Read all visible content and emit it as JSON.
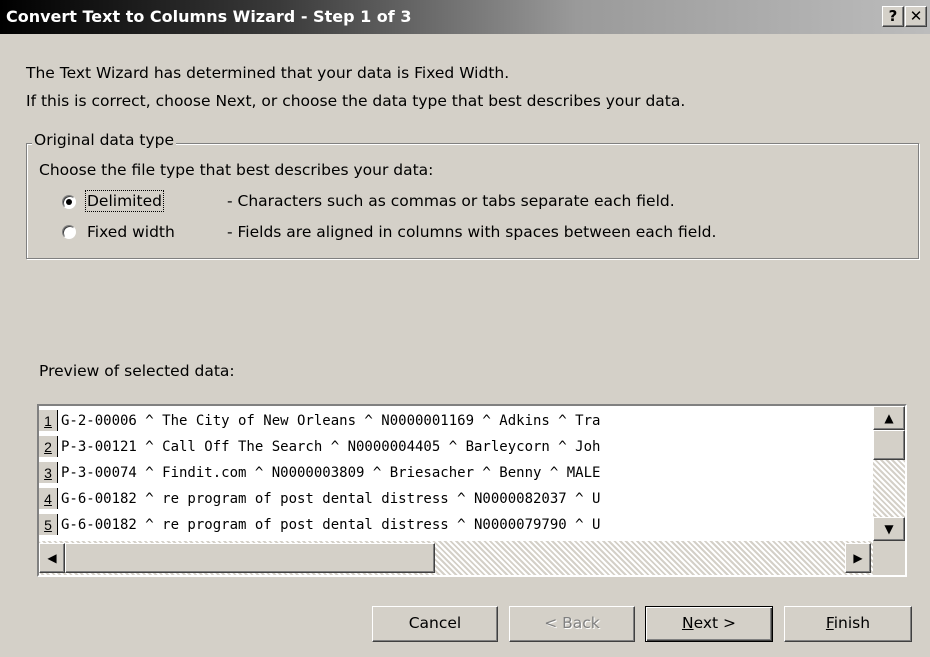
{
  "window": {
    "title": "Convert Text to Columns Wizard - Step 1 of 3",
    "help_label": "?",
    "close_label": "✕"
  },
  "intro": {
    "line1": "The Text Wizard has determined that your data is Fixed Width.",
    "line2": "If this is correct, choose Next, or choose the data type that best describes your data."
  },
  "original_data_type": {
    "group_title": "Original data type",
    "prompt": "Choose the file type that best describes your data:",
    "options": [
      {
        "label": "Delimited",
        "description": "- Characters such as commas or tabs separate each field.",
        "selected": true
      },
      {
        "label": "Fixed width",
        "description": "- Fields are aligned in columns with spaces between each field.",
        "selected": false
      }
    ]
  },
  "preview": {
    "label": "Preview of selected data:",
    "rows": [
      {
        "num": "1",
        "text": "G-2-00006 ^ The City of New Orleans ^ N0000001169 ^ Adkins ^ Tra"
      },
      {
        "num": "2",
        "text": "P-3-00121 ^ Call Off The Search ^ N0000004405 ^ Barleycorn ^ Joh"
      },
      {
        "num": "3",
        "text": "P-3-00074 ^ Findit.com ^ N0000003809 ^ Briesacher ^ Benny ^ MALE"
      },
      {
        "num": "4",
        "text": "G-6-00182 ^ re program of post dental distress ^ N0000082037 ^ U"
      },
      {
        "num": "5",
        "text": "G-6-00182 ^ re program of post dental distress ^ N0000079790 ^ U"
      }
    ]
  },
  "buttons": {
    "cancel": "Cancel",
    "back": "< Back",
    "next_u": "N",
    "next_rest": "ext >",
    "finish_u": "F",
    "finish_rest": "inish"
  },
  "icons": {
    "scroll_up": "▲",
    "scroll_down": "▼",
    "scroll_left": "◀",
    "scroll_right": "▶"
  }
}
